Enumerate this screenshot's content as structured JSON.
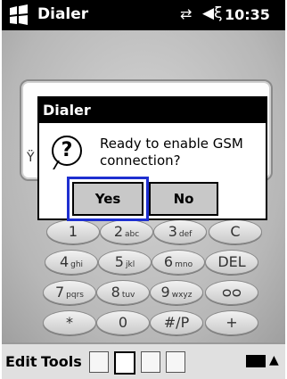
{
  "status_bar": {
    "app_title": "Dialer",
    "connectivity_icon": "connectivity-icon",
    "volume_icon": "volume-icon",
    "time": "10:35"
  },
  "dialog": {
    "title": "Dialer",
    "message": "Ready to enable GSM connection?",
    "yes_label": "Yes",
    "no_label": "No",
    "focused_button": "yes",
    "focus_color": "#1e2fd0"
  },
  "keypad": {
    "keys": [
      {
        "main": "1",
        "sub": ""
      },
      {
        "main": "2",
        "sub": "abc"
      },
      {
        "main": "3",
        "sub": "def"
      },
      {
        "main": "C",
        "sub": ""
      },
      {
        "main": "4",
        "sub": "ghi"
      },
      {
        "main": "5",
        "sub": "jkl"
      },
      {
        "main": "6",
        "sub": "mno"
      },
      {
        "main": "DEL",
        "sub": ""
      },
      {
        "main": "7",
        "sub": "pqrs"
      },
      {
        "main": "8",
        "sub": "tuv"
      },
      {
        "main": "9",
        "sub": "wxyz"
      },
      {
        "main": "voicemail",
        "sub": ""
      },
      {
        "main": "*",
        "sub": ""
      },
      {
        "main": "0",
        "sub": ""
      },
      {
        "main": "#/P",
        "sub": ""
      },
      {
        "main": "+",
        "sub": ""
      }
    ]
  },
  "bottom_bar": {
    "edit_label": "Edit",
    "tools_label": "Tools"
  }
}
